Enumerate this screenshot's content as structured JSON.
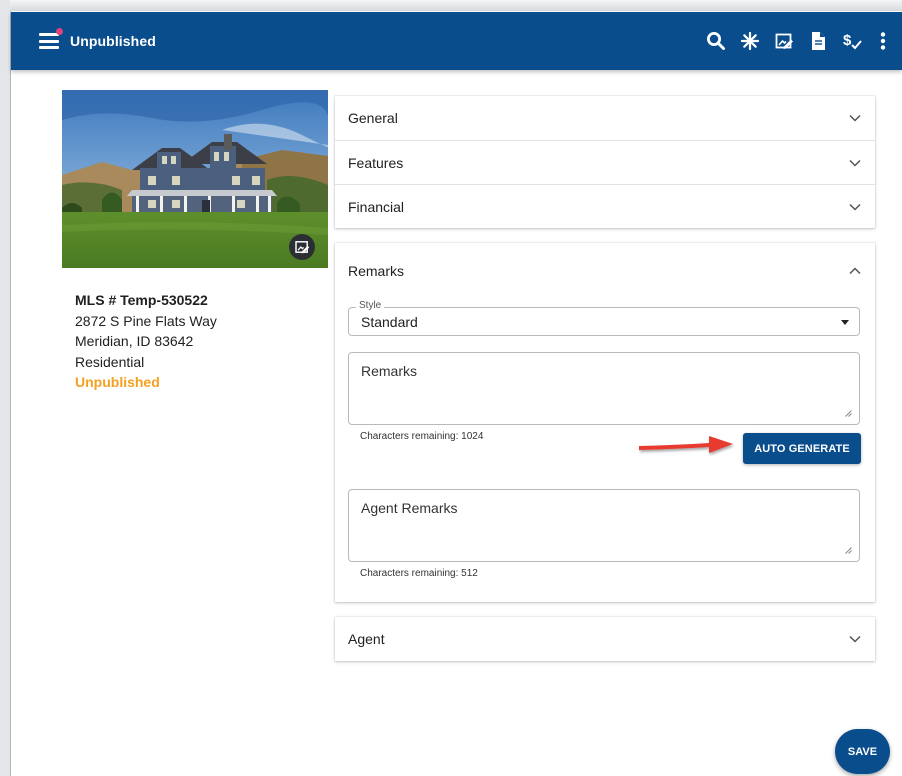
{
  "app": {
    "title": "Unpublished",
    "brand_color": "#0a4d8c"
  },
  "toolbar": {
    "actions": [
      {
        "icon": "search-icon"
      },
      {
        "icon": "asterisk-icon"
      },
      {
        "icon": "edit-photo-icon"
      },
      {
        "icon": "document-icon"
      },
      {
        "icon": "dollar-check-icon"
      },
      {
        "icon": "more-vert-icon"
      }
    ]
  },
  "listing": {
    "mls": "MLS # Temp-530522",
    "street": "2872 S Pine Flats Way",
    "city": "Meridian, ID 83642",
    "type": "Residential",
    "status": "Unpublished",
    "status_color": "#f5a020"
  },
  "sections": {
    "general": "General",
    "features": "Features",
    "financial": "Financial",
    "remarks": "Remarks",
    "agent": "Agent"
  },
  "remarks": {
    "style_label": "Style",
    "style_value": "Standard",
    "remarks_placeholder": "Remarks",
    "remarks_helper": "Characters remaining: 1024",
    "auto_generate": "AUTO GENERATE",
    "agent_remarks_placeholder": "Agent Remarks",
    "agent_helper": "Characters remaining: 512"
  },
  "save_label": "SAVE"
}
